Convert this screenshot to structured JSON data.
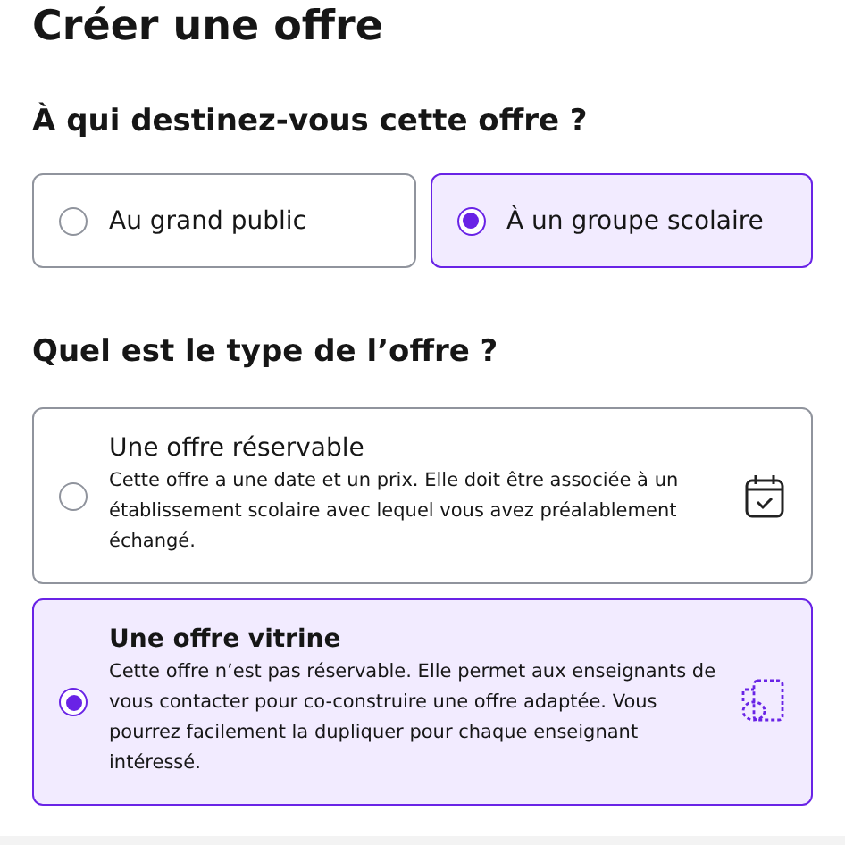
{
  "title": "Créer une offre",
  "audience": {
    "heading": "À qui destinez-vous cette offre ?",
    "options": [
      {
        "label": "Au grand public",
        "selected": false
      },
      {
        "label": "À un groupe scolaire",
        "selected": true
      }
    ]
  },
  "offer_type": {
    "heading": "Quel est le type de l’offre ?",
    "options": [
      {
        "kind": "bookable",
        "title": "Une offre réservable",
        "description": "Cette offre a une date et un prix. Elle doit être associée à un établissement scolaire avec lequel vous avez préalablement échangé.",
        "selected": false
      },
      {
        "kind": "showcase",
        "title": "Une offre vitrine",
        "description": "Cette offre n’est pas réservable. Elle permet aux enseignants de vous contacter pour co-construire une offre adaptée. Vous pourrez facilement la dupliquer pour chaque enseignant intéressé.",
        "selected": true
      }
    ]
  }
}
